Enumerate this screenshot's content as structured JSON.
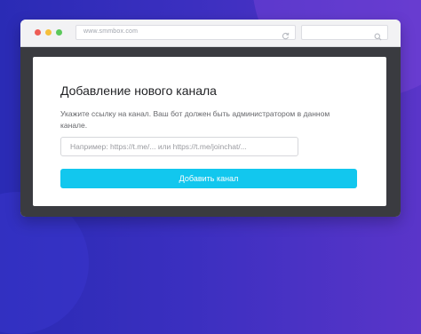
{
  "browser": {
    "address": "www.smmbox.com",
    "traffic_lights": {
      "close_color": "#ee5c55",
      "minimize_color": "#f5bf3c",
      "maximize_color": "#5bc85b"
    }
  },
  "form": {
    "title": "Добавление нового канала",
    "description": "Укажите ссылку на канал. Ваш бот должен быть администратором в данном канале.",
    "input_placeholder": "Например: https://t.me/... или https://t.me/joinchat/...",
    "input_value": "",
    "button_label": "Добавить канал",
    "button_color": "#12c7ee"
  },
  "colors": {
    "background_gradient_start": "#2a2bb5",
    "background_gradient_end": "#5a35c9",
    "viewport": "#3a3b40",
    "card": "#ffffff"
  },
  "icons": {
    "reload": "reload-icon",
    "search": "search-icon"
  }
}
